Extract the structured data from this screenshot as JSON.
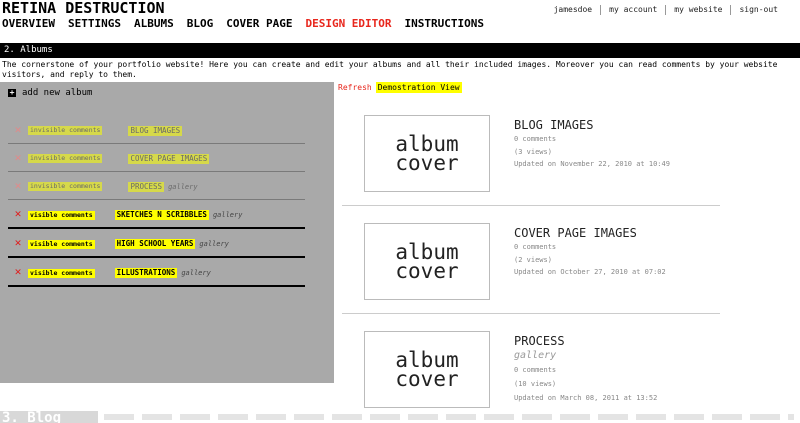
{
  "app": {
    "title": "RETINA DESTRUCTION",
    "nav": [
      "OVERVIEW",
      "SETTINGS",
      "ALBUMS",
      "BLOG",
      "COVER PAGE",
      "DESIGN EDITOR",
      "INSTRUCTIONS"
    ],
    "active_nav": "DESIGN EDITOR",
    "accent_color": "#e8261c",
    "highlight_color": "#ffff00"
  },
  "user_nav": [
    "jamesdoe",
    "my account",
    "my website",
    "sign-out"
  ],
  "section": {
    "title": "2. Albums",
    "description": "The cornerstone of your portfolio website! Here you can create and edit your albums and all their included images. Moreover you can read comments by your website visitors, and reply to them."
  },
  "left": {
    "add_label": "add new album",
    "add_icon": "+",
    "delete_icon": "✕",
    "albums": [
      {
        "comments": "invisible comments",
        "name": "BLOG IMAGES",
        "gallery": ""
      },
      {
        "comments": "invisible comments",
        "name": "COVER PAGE IMAGES",
        "gallery": ""
      },
      {
        "comments": "invisible comments",
        "name": "PROCESS",
        "gallery": "gallery"
      },
      {
        "comments": "visible comments",
        "name": "SKETCHES N SCRIBBLES",
        "gallery": "gallery"
      },
      {
        "comments": "visible comments",
        "name": "HIGH SCHOOL YEARS",
        "gallery": "gallery"
      },
      {
        "comments": "visible comments",
        "name": "ILLUSTRATIONS",
        "gallery": "gallery"
      }
    ]
  },
  "right": {
    "refresh": "Refresh",
    "demo_view": "Demostration View",
    "cover_text_1": "album",
    "cover_text_2": "cover",
    "cards": [
      {
        "title": "BLOG IMAGES",
        "gallery": "",
        "comments": "0 comments",
        "views": "(3 views)",
        "updated": "Updated on November 22, 2010 at 10:49"
      },
      {
        "title": "COVER PAGE IMAGES",
        "gallery": "",
        "comments": "0 comments",
        "views": "(2 views)",
        "updated": "Updated on October 27, 2010 at 07:02"
      },
      {
        "title": "PROCESS",
        "gallery": "gallery",
        "comments": "0 comments",
        "views": "(10 views)",
        "updated": "Updated on March 08, 2011 at 13:52"
      }
    ]
  },
  "footer": {
    "partial_heading": "3. Blog"
  }
}
